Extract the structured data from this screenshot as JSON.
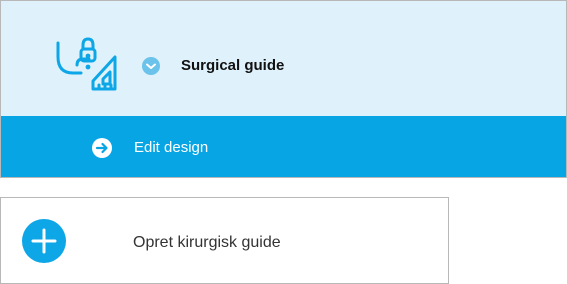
{
  "panel": {
    "title": "Surgical guide",
    "icon": "surgical-guide-icon",
    "status_icon": "chevron-down-icon",
    "action": {
      "label": "Edit design",
      "icon": "arrow-right-icon"
    }
  },
  "create": {
    "label": "Opret kirurgisk guide",
    "icon": "plus-icon"
  },
  "colors": {
    "panel_bg": "#dff2fb",
    "action_bg": "#08a5e5",
    "accent": "#0da6e6",
    "status_dot": "#6bc2ea",
    "border": "#b8b8b8"
  }
}
